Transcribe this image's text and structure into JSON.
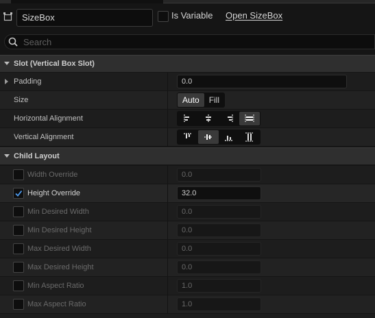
{
  "header": {
    "widget_name": "SizeBox",
    "is_variable_label": "Is Variable",
    "is_variable_checked": false,
    "open_link": "Open SizeBox"
  },
  "search": {
    "placeholder": "Search"
  },
  "slot_category": {
    "label": "Slot (Vertical Box Slot)",
    "padding": {
      "label": "Padding",
      "value": "0.0"
    },
    "size": {
      "label": "Size",
      "options": [
        "Auto",
        "Fill"
      ],
      "selected": "Auto"
    },
    "horizontal_alignment": {
      "label": "Horizontal Alignment",
      "options": [
        "align-left-icon",
        "align-center-horizontal-icon",
        "align-right-icon",
        "fill-horizontal-icon"
      ],
      "selected": "fill-horizontal-icon"
    },
    "vertical_alignment": {
      "label": "Vertical Alignment",
      "options": [
        "align-top-icon",
        "align-center-vertical-icon",
        "align-bottom-icon",
        "fill-vertical-icon"
      ],
      "selected": "align-center-vertical-icon"
    }
  },
  "child_layout": {
    "label": "Child Layout",
    "rows": [
      {
        "label": "Width Override",
        "value": "0.0",
        "enabled": false
      },
      {
        "label": "Height Override",
        "value": "32.0",
        "enabled": true
      },
      {
        "label": "Min Desired Width",
        "value": "0.0",
        "enabled": false
      },
      {
        "label": "Min Desired Height",
        "value": "0.0",
        "enabled": false
      },
      {
        "label": "Max Desired Width",
        "value": "0.0",
        "enabled": false
      },
      {
        "label": "Max Desired Height",
        "value": "0.0",
        "enabled": false
      },
      {
        "label": "Min Aspect Ratio",
        "value": "1.0",
        "enabled": false
      },
      {
        "label": "Max Aspect Ratio",
        "value": "1.0",
        "enabled": false
      }
    ]
  },
  "colors": {
    "accent_check": "#4d9bf0",
    "panel_bg": "#151515",
    "category_bg": "#2f2f2f"
  }
}
